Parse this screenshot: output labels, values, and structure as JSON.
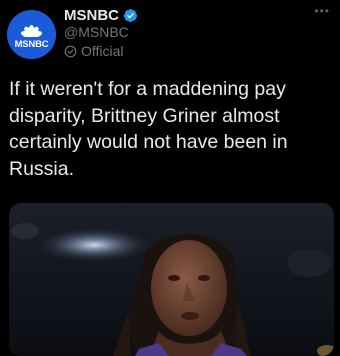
{
  "account": {
    "display_name": "MSNBC",
    "handle": "@MSNBC",
    "label": "Official",
    "avatar_text": "MSNBC",
    "verified": true
  },
  "tweet": {
    "text": "If it weren't for a maddening pay disparity, Brittney Griner almost certainly would not have been in Russia."
  },
  "more_menu": "•••",
  "icons": {
    "avatar": "msnbc-peacock-logo",
    "verified": "verified-badge-icon",
    "official": "check-circle-icon",
    "more": "more-options-icon"
  },
  "colors": {
    "background": "#000000",
    "text_primary": "#e7e9ea",
    "text_secondary": "#71767b",
    "verified_blue": "#1d9bf0",
    "avatar_blue": "#1c5bd8"
  }
}
